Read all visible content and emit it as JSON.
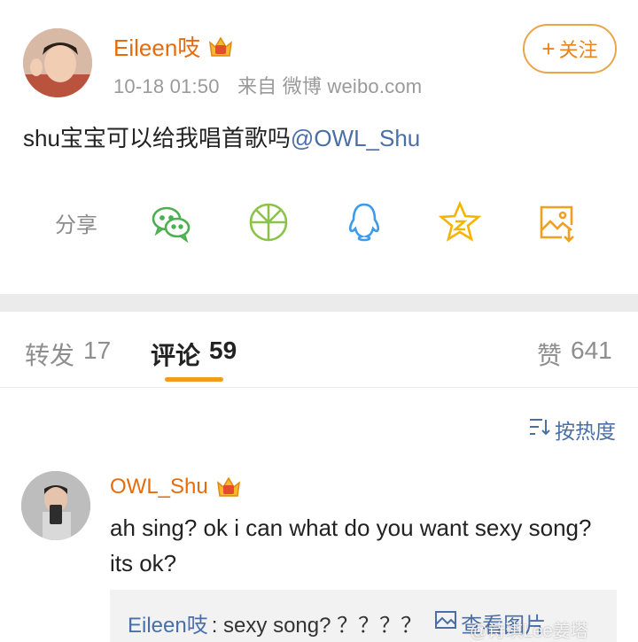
{
  "post": {
    "author": "Eileen吱",
    "time": "10-18 01:50",
    "source": "来自 微博 weibo.com",
    "follow_label": "关注",
    "text_prefix": "shu宝宝可以给我唱首歌吗",
    "mention": "@OWL_Shu",
    "share_label": "分享",
    "share_icons": [
      "wechat-icon",
      "moments-icon",
      "qq-icon",
      "qzone-icon",
      "save-image-icon"
    ]
  },
  "tabs": {
    "repost_label": "转发",
    "repost_count": "17",
    "comment_label": "评论",
    "comment_count": "59",
    "like_label": "赞",
    "like_count": "641"
  },
  "sort_label": "按热度",
  "comment": {
    "author": "OWL_Shu",
    "text": "ah sing? ok i can what do you want  sexy song? its ok?",
    "reply_author": "Eileen吱",
    "reply_text": ": sexy song? ？？？？",
    "view_image_label": "查看图片"
  },
  "watermark": "@诗琪Lee姜塔",
  "colors": {
    "author": "#e86b0a",
    "link": "#4a6fa8",
    "accent": "#f29b1d"
  }
}
